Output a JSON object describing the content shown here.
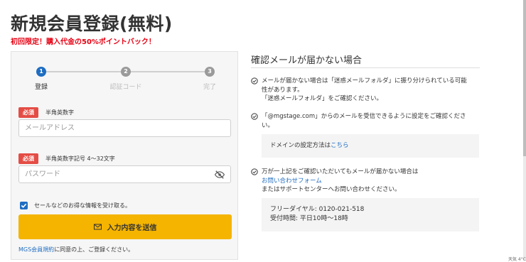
{
  "page": {
    "title": "新規会員登録(無料)",
    "promo": "初回限定！購入代金の50%ポイントバック！"
  },
  "steps": [
    {
      "number": "1",
      "label": "登録",
      "active": true
    },
    {
      "number": "2",
      "label": "認証コード",
      "active": false
    },
    {
      "number": "3",
      "label": "完了",
      "active": false
    }
  ],
  "form": {
    "email": {
      "required_badge": "必須",
      "hint": "半角英数字",
      "placeholder": "メールアドレス",
      "value": ""
    },
    "password": {
      "required_badge": "必須",
      "hint": "半角英数字記号 4〜32文字",
      "placeholder": "パスワード",
      "value": ""
    },
    "newsletter": {
      "label": "セールなどのお得な情報を受け取る。",
      "checked": true
    },
    "submit_label": "入力内容を送信",
    "terms_link": "MGS会員規約",
    "terms_text": "に同意の上、ご登録ください。"
  },
  "help": {
    "title": "確認メールが届かない場合",
    "item1": {
      "line1": "メールが届かない場合は「迷惑メールフォルダ」に振り分けられている可能",
      "line2": "性があります。",
      "line3": "「迷惑メールフォルダ」をご確認ください。"
    },
    "item2": {
      "line1": "「@mgstage.com」からのメールを受信できるように設定をご確認くださ",
      "line2": "い。",
      "box_text": "ドメインの設定方法は",
      "box_link": "こちら"
    },
    "item3": {
      "line1": "万が一上記をご確認いただいてもメールが届かない場合は",
      "link": "お問い合わせフォーム",
      "line3": "またはサポートセンターへお問い合わせください。",
      "phone_label": "フリーダイヤル: 0120-021-518",
      "hours_label": "受付時間: 平日10時〜18時"
    }
  },
  "taskbar": {
    "text": "天気 4°C"
  },
  "colors": {
    "primary": "#1f6dc2",
    "accent": "#f5b400",
    "required": "#e44d45",
    "promo": "#e60012"
  },
  "icons": {
    "mail": "mail-icon",
    "eye": "eye-slash-icon",
    "check": "check-circle-icon"
  }
}
